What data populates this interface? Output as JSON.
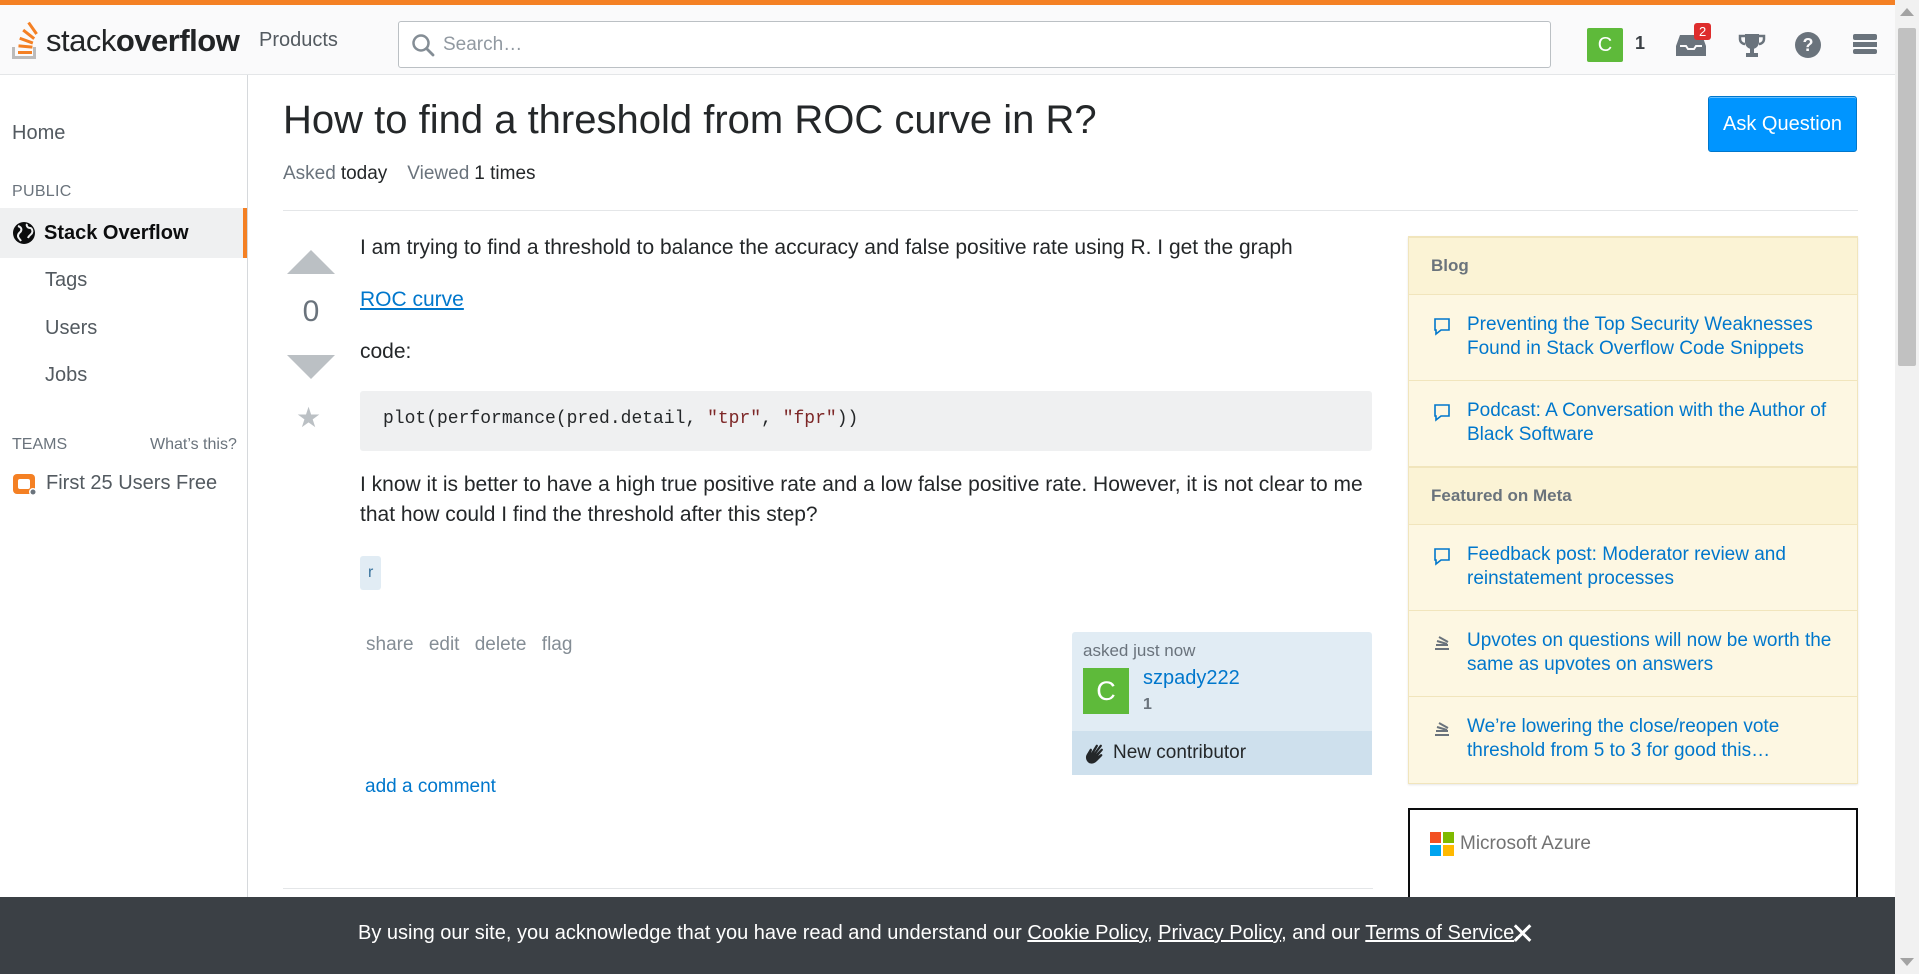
{
  "header": {
    "logo_text_regular": "stack",
    "logo_text_bold": "overflow",
    "products_label": "Products",
    "search_placeholder": "Search…",
    "avatar_letter": "C",
    "reputation": "1",
    "inbox_badge": "2"
  },
  "leftnav": {
    "home": "Home",
    "public_label": "PUBLIC",
    "stackoverflow": "Stack Overflow",
    "tags": "Tags",
    "users": "Users",
    "jobs": "Jobs",
    "teams_label": "TEAMS",
    "whats_this": "What’s this?",
    "first_users_free": "First 25 Users Free"
  },
  "question": {
    "title": "How to find a threshold from ROC curve in R?",
    "ask_button": "Ask Question",
    "asked_label": "Asked",
    "asked_value": "today",
    "viewed_label": "Viewed",
    "viewed_value": "1 times",
    "votes": "0",
    "para1": "I am trying to find a threshold to balance the accuracy and false positive rate using R. I get the graph",
    "link_text": "ROC curve",
    "code_label": "code:",
    "code_prefix": "plot(performance(pred.detail, ",
    "code_str1": "\"tpr\"",
    "code_sep": ", ",
    "code_str2": "\"fpr\"",
    "code_suffix": "))",
    "para2": "I know it is better to have a high true positive rate and a low false positive rate. However, it is not clear to me that how could I find the threshold after this step?",
    "tag": "r",
    "actions": [
      "share",
      "edit",
      "delete",
      "flag"
    ],
    "add_comment": "add a comment"
  },
  "usercard": {
    "asked_time": "asked just now",
    "avatar_letter": "C",
    "username": "szpady222",
    "reputation": "1",
    "new_contributor": "New contributor"
  },
  "sidebar": {
    "blog_header": "Blog",
    "blog_items": [
      "Preventing the Top Security Weaknesses Found in Stack Overflow Code Snippets",
      "Podcast: A Conversation with the Author of Black Software"
    ],
    "meta_header": "Featured on Meta",
    "meta_items": [
      "Feedback post: Moderator review and reinstatement processes",
      "Upvotes on questions will now be worth the same as upvotes on answers",
      "We’re lowering the close/reopen vote threshold from 5 to 3 for good this…"
    ]
  },
  "ad": {
    "brand": "Microsoft Azure"
  },
  "cookie": {
    "text1": "By using our site, you acknowledge that you have read and understand our ",
    "link1": "Cookie Policy",
    "sep1": ", ",
    "link2": "Privacy Policy",
    "sep2": ", and our ",
    "link3": "Terms of Service",
    "end": ".",
    "close": "✕"
  },
  "colors": {
    "brand_orange": "#f48024",
    "link_blue": "#0077cc",
    "ask_button": "#0095ff",
    "avatar_green": "#5eba3a",
    "sidebar_bg": "#fdf7e2",
    "cookie_bg": "#3b4045"
  }
}
